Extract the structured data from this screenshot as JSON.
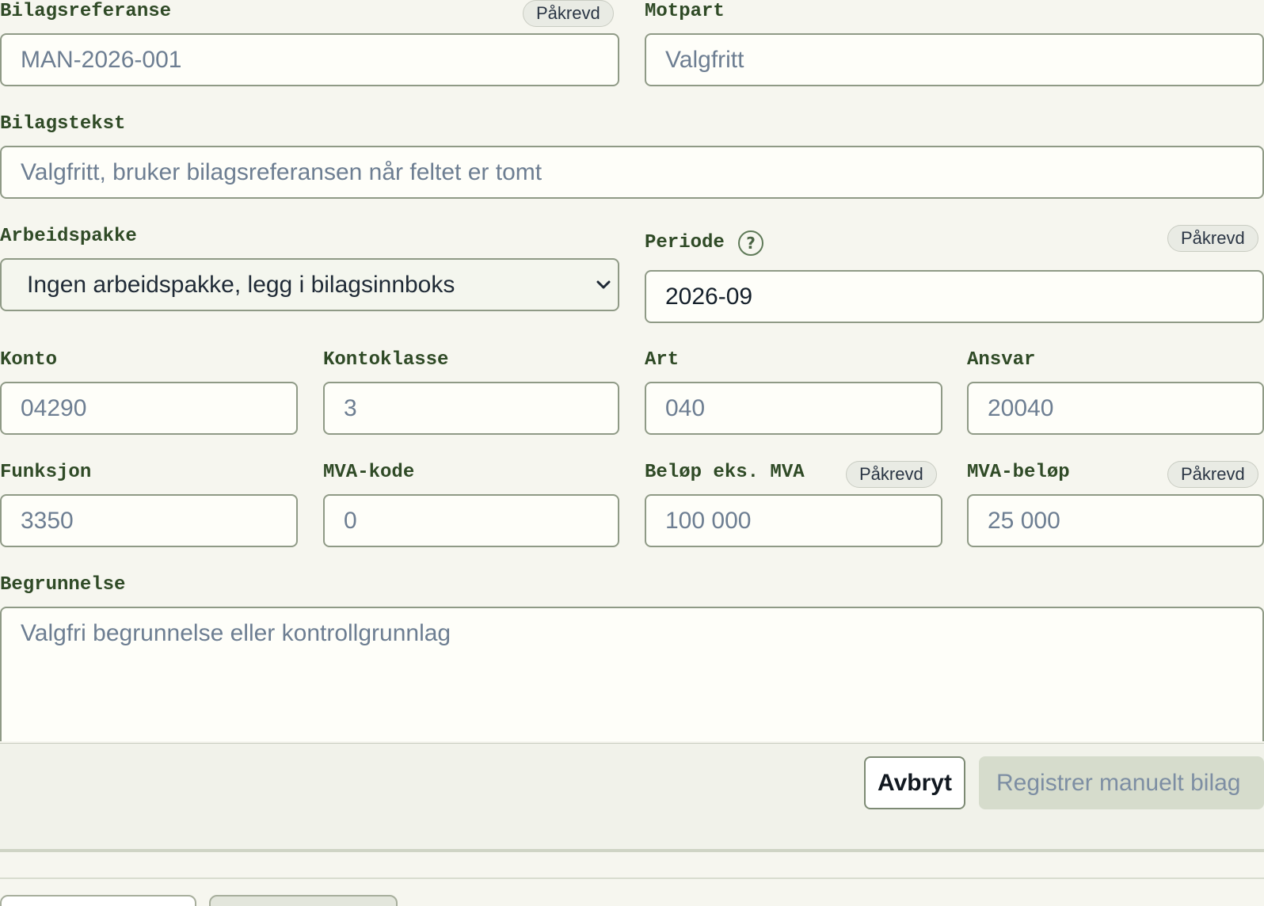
{
  "labels": {
    "bilagsreferanse": "Bilagsreferanse",
    "motpart": "Motpart",
    "bilagstekst": "Bilagstekst",
    "arbeidspakke": "Arbeidspakke",
    "periode": "Periode",
    "konto": "Konto",
    "kontoklasse": "Kontoklasse",
    "art": "Art",
    "ansvar": "Ansvar",
    "funksjon": "Funksjon",
    "mva_kode": "MVA-kode",
    "belop_eks_mva": "Beløp eks. MVA",
    "mva_belop": "MVA-beløp",
    "begrunnelse": "Begrunnelse"
  },
  "required_badge": "Påkrevd",
  "help_icon_glyph": "?",
  "placeholders": {
    "bilagsreferanse": "MAN-2026-001",
    "motpart": "Valgfritt",
    "bilagstekst": "Valgfritt, bruker bilagsreferansen når feltet er tomt",
    "konto": "04290",
    "kontoklasse": "3",
    "art": "040",
    "ansvar": "20040",
    "funksjon": "3350",
    "mva_kode": "0",
    "belop_eks_mva": "100 000",
    "mva_belop": "25 000",
    "begrunnelse": "Valgfri begrunnelse eller kontrollgrunnlag"
  },
  "values": {
    "periode": "2026-09"
  },
  "arbeidspakke_selected": "Ingen arbeidspakke, legg i bilagsinnboks",
  "buttons": {
    "cancel": "Avbryt",
    "submit": "Registrer manuelt bilag"
  },
  "colors": {
    "label": "#2f4a26",
    "field_border": "#8f9a86",
    "submit_disabled_bg": "#d6dccc"
  }
}
